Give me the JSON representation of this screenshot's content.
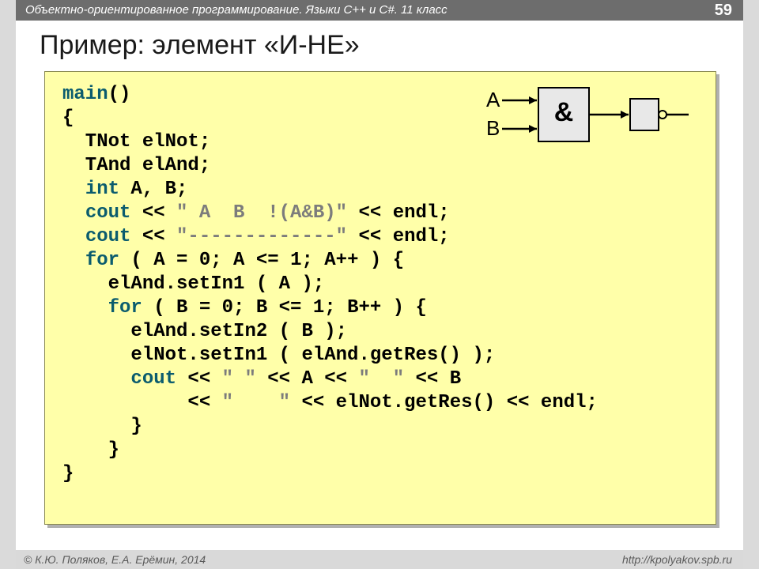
{
  "header": {
    "title": "Объектно-ориентированное программирование. Языки C++ и C#. 11 класс",
    "page": "59"
  },
  "title": "Пример: элемент «И-НЕ»",
  "code": {
    "l1a": "main",
    "l1b": "()",
    "l2": "{",
    "l3": "  TNot elNot;",
    "l4": "  TAnd elAnd;",
    "l5a": "  ",
    "l5b": "int",
    "l5c": " A, B;",
    "l6a": "  ",
    "l6b": "cout",
    "l6c": " << ",
    "l6d": "\" A  B  !(A&B)\"",
    "l6e": " << endl;",
    "l7a": "  ",
    "l7b": "cout",
    "l7c": " << ",
    "l7d": "\"-------------\"",
    "l7e": " << endl;",
    "l8a": "  ",
    "l8b": "for",
    "l8c": " ( A = 0; A <= 1; A++ ) {",
    "l9": "    elAnd.setIn1 ( A );",
    "l10a": "    ",
    "l10b": "for",
    "l10c": " ( B = 0; B <= 1; B++ ) {",
    "l11": "      elAnd.setIn2 ( B );",
    "l12": "      elNot.setIn1 ( elAnd.getRes() );",
    "l13a": "      ",
    "l13b": "cout",
    "l13c": " << ",
    "l13d": "\" \"",
    "l13e": " << A << ",
    "l13f": "\"  \"",
    "l13g": " << B",
    "l14a": "           << ",
    "l14b": "\"    \"",
    "l14c": " << elNot.getRes() << endl;",
    "l15": "      }",
    "l16": "    }",
    "l17": "}"
  },
  "diagram": {
    "inA": "A",
    "inB": "B",
    "gate": "&"
  },
  "footer": {
    "left": "© К.Ю. Поляков, Е.А. Ерёмин, 2014",
    "right": "http://kpolyakov.spb.ru"
  }
}
